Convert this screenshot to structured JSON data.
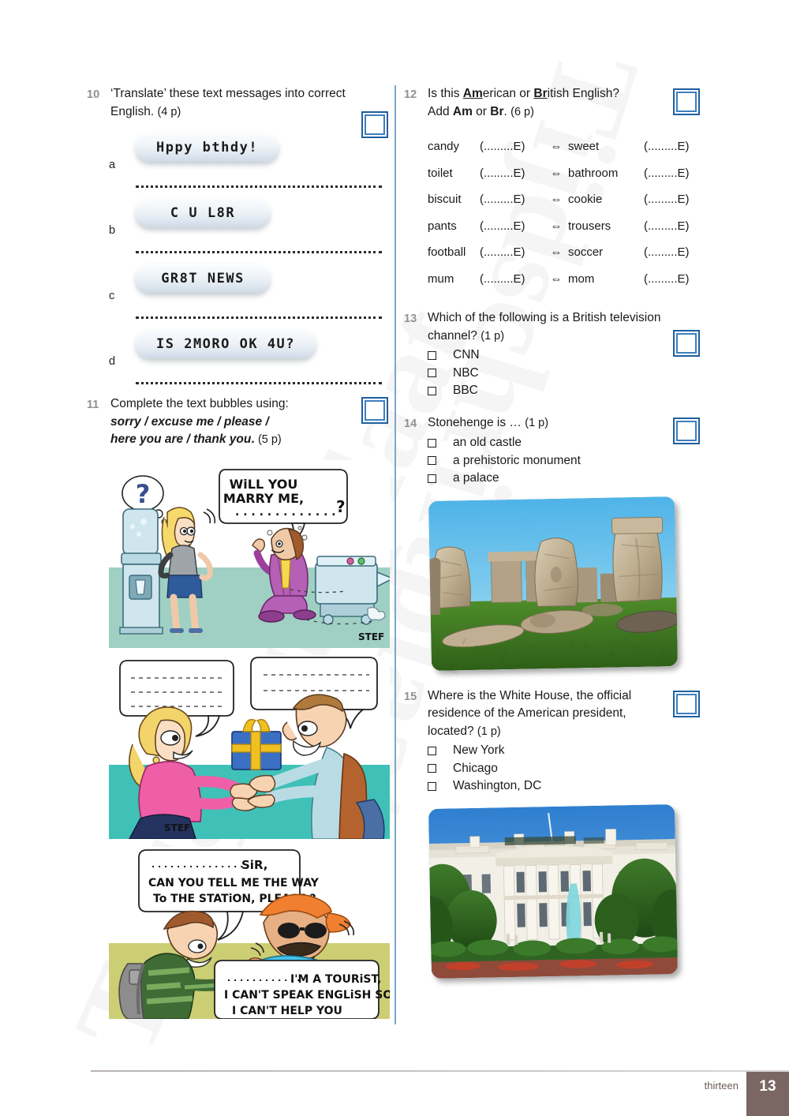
{
  "page": {
    "footer_word": "thirteen",
    "footer_number": "13",
    "watermark_text": "Tijdschriftplaat",
    "accent_blue": "#1f5fa0",
    "divider_blue": "#7ba7cc",
    "footer_brown": "#7a6663"
  },
  "q10": {
    "number": "10",
    "prompt_line1": "‘Translate’ these text messages into correct",
    "prompt_line2": "English.",
    "points": "(4 p)",
    "items": [
      {
        "letter": "a",
        "message": "Hppy bthdy!"
      },
      {
        "letter": "b",
        "message": "C U L8R"
      },
      {
        "letter": "c",
        "message": "GR8T NEWS"
      },
      {
        "letter": "d",
        "message": "IS 2MORO OK 4U?"
      }
    ]
  },
  "q11": {
    "number": "11",
    "prompt_line1": "Complete the text bubbles using:",
    "prompt_line2": "sorry / excuse me / please /",
    "prompt_line3": "here you are / thank you",
    "points": "(5 p)",
    "cartoons": [
      {
        "name": "marry-me-cartoon",
        "bubble_line1": "WiLL YOU",
        "bubble_line2": "MARRY  ME,",
        "bubble_line3": ". . . . . . . . . . . . . ?",
        "signature": "STEF"
      },
      {
        "name": "gift-cartoon",
        "bubble_left": "blank dotted lines",
        "bubble_right": "blank dotted lines",
        "signature": "STEF"
      },
      {
        "name": "tourist-cartoon",
        "bubble_top_line1": ". . . . . . . . . . . . . . .  SiR,",
        "bubble_top_line2": "CAN YOU TELL ME THE WAY",
        "bubble_top_line3": "To THE STATiON, PLEASE ?",
        "bubble_bottom_line1": ". . . . . . . . . . . .  I'M A TOURiST,",
        "bubble_bottom_line2": "I CAN'T SPEAK ENGLiSH SO",
        "bubble_bottom_line3": "I CAN'T HELP  YOU"
      }
    ]
  },
  "q12": {
    "number": "12",
    "prompt_line1_a": "Is this ",
    "prompt_line1_am": "Am",
    "prompt_line1_b": "erican or ",
    "prompt_line1_br": "Br",
    "prompt_line1_c": "itish English?",
    "prompt_line2_a": "Add ",
    "prompt_line2_am": "Am",
    "prompt_line2_b": " or ",
    "prompt_line2_br": "Br",
    "prompt_line2_c": ".",
    "points": "(6 p)",
    "blank": "(.........E)",
    "arrow": "⇔",
    "rows": [
      {
        "left": "candy",
        "right": "sweet"
      },
      {
        "left": "toilet",
        "right": "bathroom"
      },
      {
        "left": "biscuit",
        "right": "cookie"
      },
      {
        "left": "pants",
        "right": "trousers"
      },
      {
        "left": "football",
        "right": "soccer"
      },
      {
        "left": "mum",
        "right": "mom"
      }
    ]
  },
  "q13": {
    "number": "13",
    "prompt_line1": "Which of the following is a British television",
    "prompt_line2": "channel?",
    "points": "(1 p)",
    "options": [
      "CNN",
      "NBC",
      "BBC"
    ]
  },
  "q14": {
    "number": "14",
    "prompt_line1": "Stonehenge is …",
    "points": "(1 p)",
    "options": [
      "an old castle",
      "a prehistoric monument",
      "a palace"
    ],
    "photo_caption": "stonehenge-photo"
  },
  "q15": {
    "number": "15",
    "prompt_line1": "Where is the White House, the official",
    "prompt_line2": "residence of the American president,",
    "prompt_line3": "located?",
    "points": "(1 p)",
    "options": [
      "New York",
      "Chicago",
      "Washington, DC"
    ],
    "photo_caption": "white-house-photo"
  }
}
